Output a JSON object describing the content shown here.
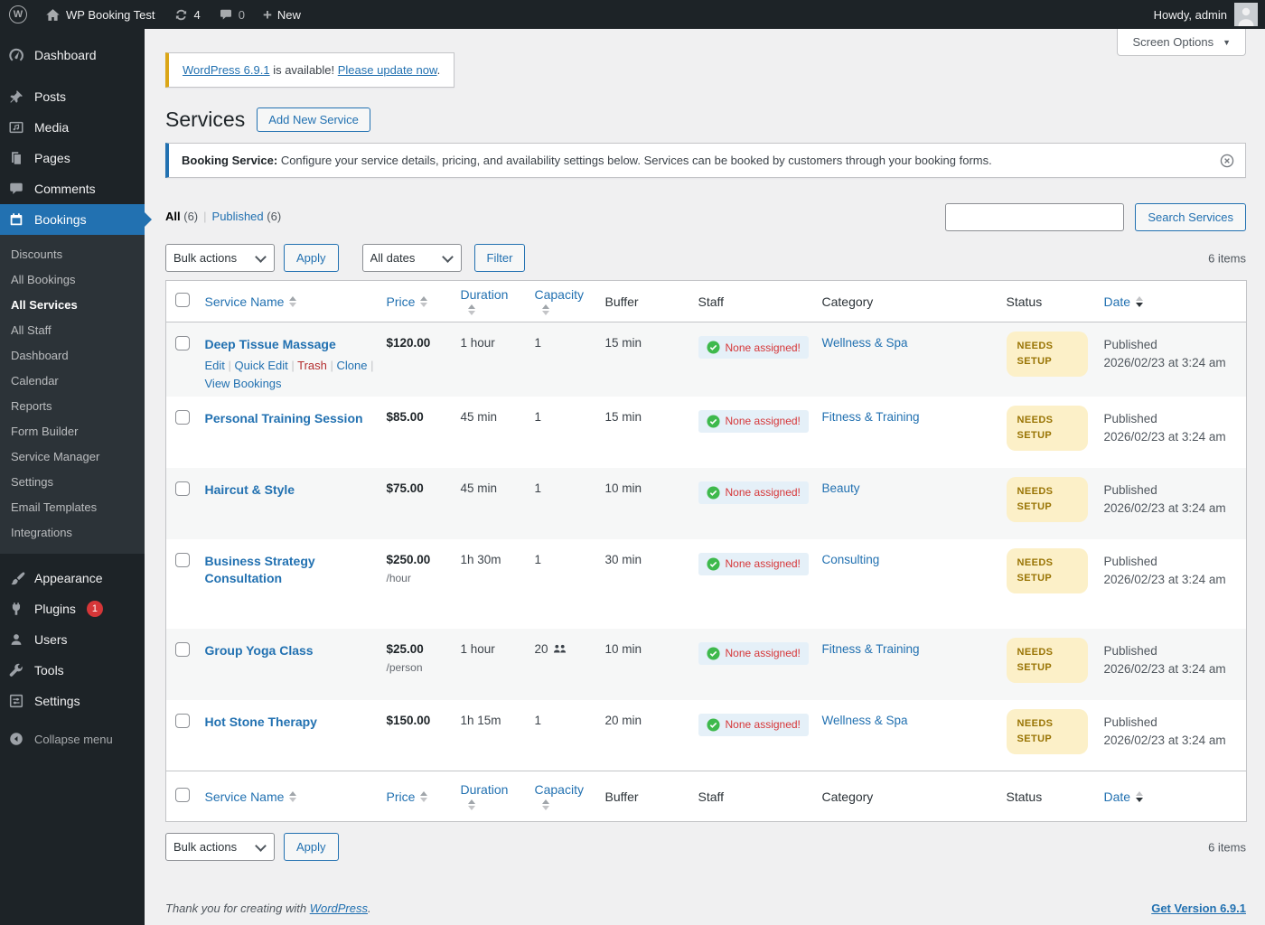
{
  "admin_bar": {
    "site_name": "WP Booking Test",
    "update_count": "4",
    "comment_count": "0",
    "new_label": "New",
    "howdy": "Howdy, admin"
  },
  "sidebar": {
    "dashboard": "Dashboard",
    "posts": "Posts",
    "media": "Media",
    "pages": "Pages",
    "comments": "Comments",
    "bookings": "Bookings",
    "appearance": "Appearance",
    "plugins": "Plugins",
    "plugins_badge": "1",
    "users": "Users",
    "tools": "Tools",
    "settings": "Settings",
    "collapse": "Collapse menu",
    "submenu": {
      "discounts": "Discounts",
      "all_bookings": "All Bookings",
      "all_services": "All Services",
      "all_staff": "All Staff",
      "dashboard": "Dashboard",
      "calendar": "Calendar",
      "reports": "Reports",
      "form_builder": "Form Builder",
      "service_manager": "Service Manager",
      "settings": "Settings",
      "email_templates": "Email Templates",
      "integrations": "Integrations"
    }
  },
  "screen_options": "Screen Options",
  "update_nag": {
    "link1": "WordPress 6.9.1",
    "middle": " is available! ",
    "link2": "Please update now",
    "suffix": "."
  },
  "page": {
    "title": "Services",
    "add_new": "Add New Service"
  },
  "notice": {
    "bold": "Booking Service:",
    "text": " Configure your service details, pricing, and availability settings below. Services can be booked by customers through your booking forms."
  },
  "filters": {
    "all": "All",
    "all_count": "(6)",
    "published": "Published",
    "published_count": "(6)"
  },
  "search": {
    "value": "",
    "button": "Search Services"
  },
  "tablenav": {
    "bulk_actions": "Bulk actions",
    "apply": "Apply",
    "all_dates": "All dates",
    "filter": "Filter",
    "items": "6 items"
  },
  "columns": {
    "name": "Service Name",
    "price": "Price",
    "duration": "Duration",
    "capacity": "Capacity",
    "buffer": "Buffer",
    "staff": "Staff",
    "category": "Category",
    "status": "Status",
    "date": "Date"
  },
  "row_actions": {
    "edit": "Edit",
    "quick_edit": "Quick Edit",
    "trash": "Trash",
    "clone": "Clone",
    "view_bookings": "View Bookings"
  },
  "rows": [
    {
      "name": "Deep Tissue Massage",
      "price": "$120.00",
      "duration": "1 hour",
      "capacity": "1",
      "buffer": "15 min",
      "staff": "None assigned!",
      "category": "Wellness & Spa",
      "status": "NEEDS SETUP",
      "date1": "Published",
      "date2": "2026/02/23 at 3:24 am"
    },
    {
      "name": "Personal Training Session",
      "price": "$85.00",
      "duration": "45 min",
      "capacity": "1",
      "buffer": "15 min",
      "staff": "None assigned!",
      "category": "Fitness & Training",
      "status": "NEEDS SETUP",
      "date1": "Published",
      "date2": "2026/02/23 at 3:24 am"
    },
    {
      "name": "Haircut & Style",
      "price": "$75.00",
      "duration": "45 min",
      "capacity": "1",
      "buffer": "10 min",
      "staff": "None assigned!",
      "category": "Beauty",
      "status": "NEEDS SETUP",
      "date1": "Published",
      "date2": "2026/02/23 at 3:24 am"
    },
    {
      "name": "Business Strategy Consultation",
      "price": "$250.00",
      "price_note": "/hour",
      "duration": "1h 30m",
      "capacity": "1",
      "buffer": "30 min",
      "staff": "None assigned!",
      "category": "Consulting",
      "status": "NEEDS SETUP",
      "date1": "Published",
      "date2": "2026/02/23 at 3:24 am"
    },
    {
      "name": "Group Yoga Class",
      "price": "$25.00",
      "price_note": "/person",
      "duration": "1 hour",
      "capacity": "20",
      "buffer": "10 min",
      "staff": "None assigned!",
      "category": "Fitness & Training",
      "status": "NEEDS SETUP",
      "date1": "Published",
      "date2": "2026/02/23 at 3:24 am"
    },
    {
      "name": "Hot Stone Therapy",
      "price": "$150.00",
      "duration": "1h 15m",
      "capacity": "1",
      "buffer": "20 min",
      "staff": "None assigned!",
      "category": "Wellness & Spa",
      "status": "NEEDS SETUP",
      "date1": "Published",
      "date2": "2026/02/23 at 3:24 am"
    }
  ],
  "footer": {
    "thanks_prefix": "Thank you for creating with ",
    "thanks_link": "WordPress",
    "thanks_suffix": ".",
    "version": "Get Version 6.9.1"
  }
}
